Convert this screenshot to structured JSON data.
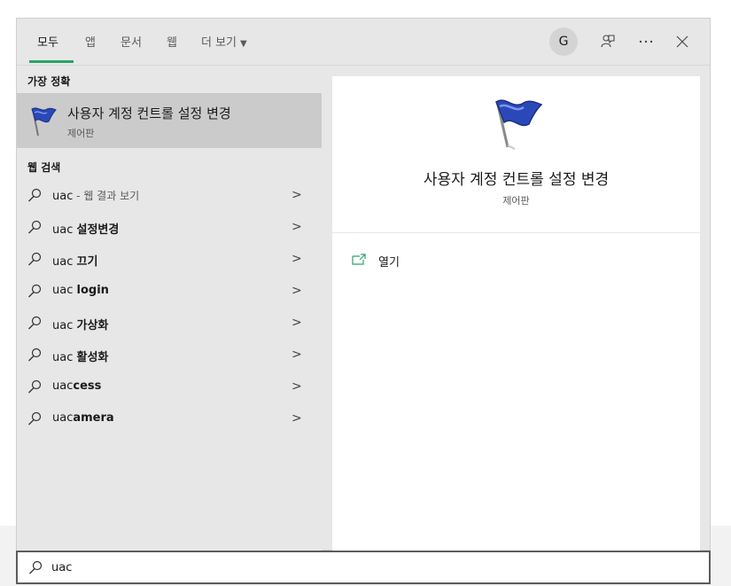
{
  "tabs": [
    {
      "label": "모두"
    },
    {
      "label": "앱"
    },
    {
      "label": "문서"
    },
    {
      "label": "웹"
    },
    {
      "label": "더 보기"
    }
  ],
  "header": {
    "avatar_letter": "G"
  },
  "best_match": {
    "section_title": "가장 정확",
    "title": "사용자 계정 컨트롤 설정 변경",
    "subtitle": "제어판",
    "icon": "blue-flag-icon"
  },
  "web_search": {
    "section_title": "웹 검색",
    "items": [
      {
        "prefix": "uac",
        "bold": "",
        "hint": " - 웹 결과 보기"
      },
      {
        "prefix": "uac ",
        "bold": "설정변경",
        "hint": ""
      },
      {
        "prefix": "uac ",
        "bold": "끄기",
        "hint": ""
      },
      {
        "prefix": "uac ",
        "bold": "login",
        "hint": ""
      },
      {
        "prefix": "uac ",
        "bold": "가상화",
        "hint": ""
      },
      {
        "prefix": "uac ",
        "bold": "활성화",
        "hint": ""
      },
      {
        "prefix": "uac",
        "bold": "cess",
        "hint": ""
      },
      {
        "prefix": "uac",
        "bold": "amera",
        "hint": ""
      }
    ]
  },
  "preview": {
    "title": "사용자 계정 컨트롤 설정 변경",
    "subtitle": "제어판",
    "actions": [
      {
        "label": "열기",
        "icon": "open-window-icon"
      }
    ]
  },
  "search": {
    "value": "uac"
  },
  "colors": {
    "accent": "#2ba36a",
    "selected_bg": "#cbcbcb",
    "panel_bg": "#e7e7e7"
  }
}
